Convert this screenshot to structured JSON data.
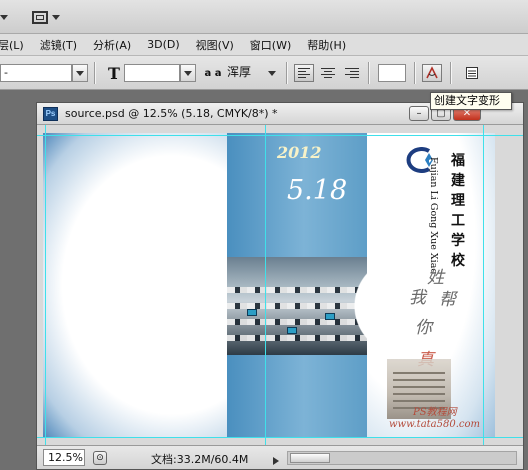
{
  "menubar": {
    "items": [
      "层(L)",
      "滤镜(T)",
      "分析(A)",
      "3D(D)",
      "视图(V)",
      "窗口(W)",
      "帮助(H)"
    ]
  },
  "options": {
    "font_style": "-",
    "font_size_icon": "T",
    "font_size_value": "",
    "aa_label": "a a",
    "aa_value": "浑厚",
    "text_color_swatch": "#ffffff"
  },
  "tooltip": {
    "text": "创建文字变形"
  },
  "document": {
    "ps_badge": "Ps",
    "title": "source.psd @ 12.5% (5.18, CMYK/8*) *",
    "min_label": "–",
    "max_label": "▢",
    "close_label": "✕"
  },
  "artwork": {
    "year": "2012",
    "date": "5.18",
    "school_name_chars": [
      "福",
      "建",
      "理",
      "工",
      "学",
      "校"
    ],
    "pinyin": "Fujian Li Gong Xue Xiao",
    "calligraphy": [
      "姓",
      "我",
      "帮",
      "你"
    ],
    "seal": "真",
    "watermark_1": "PS教程网",
    "watermark_2": "www.tata580.com"
  },
  "statusbar": {
    "zoom": "12.5%",
    "doc_info": "文档:33.2M/60.4M"
  }
}
